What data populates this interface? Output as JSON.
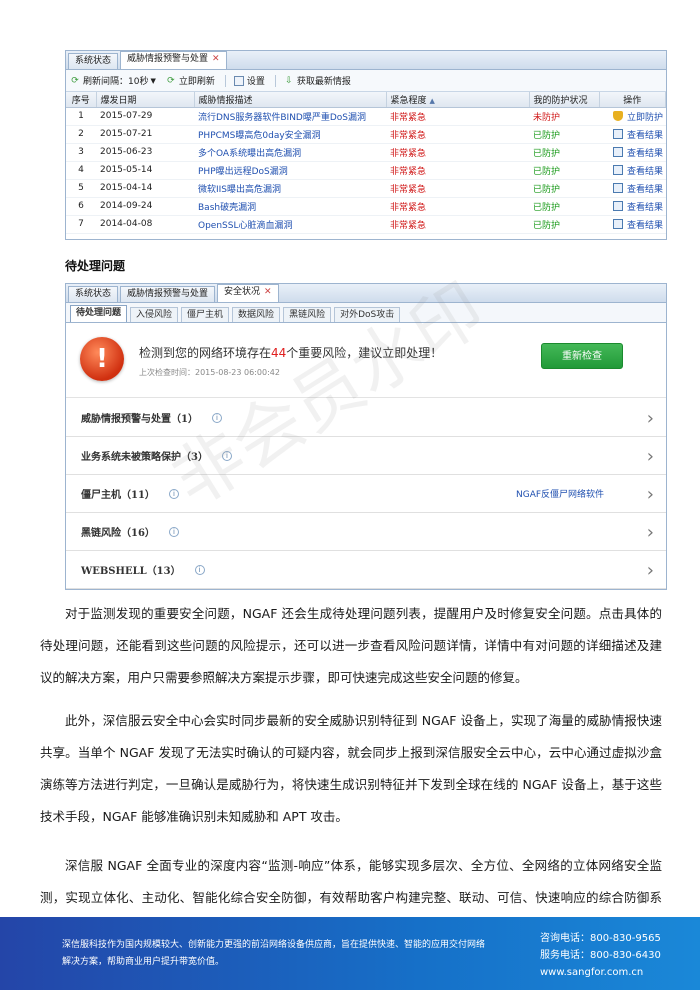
{
  "shot1": {
    "tabs": [
      "系统状态",
      "威胁情报预警与处置"
    ],
    "toolbar": {
      "refresh_interval": "刷新间隔：10秒",
      "refresh_now": "立即刷新",
      "settings": "设置",
      "get_latest": "获取最新情报"
    },
    "columns": [
      "序号",
      "爆发日期",
      "威胁情报描述",
      "紧急程度",
      "我的防护状况",
      "操作"
    ],
    "rows": [
      {
        "idx": "1",
        "date": "2015-07-29",
        "desc": "流行DNS服务器软件BIND曝严重DoS漏洞",
        "urgency": "非常紧急",
        "protect": "未防护",
        "op": "立即防护"
      },
      {
        "idx": "2",
        "date": "2015-07-21",
        "desc": "PHPCMS曝高危0day安全漏洞",
        "urgency": "非常紧急",
        "protect": "已防护",
        "op": "查看结果"
      },
      {
        "idx": "3",
        "date": "2015-06-23",
        "desc": "多个OA系统曝出高危漏洞",
        "urgency": "非常紧急",
        "protect": "已防护",
        "op": "查看结果"
      },
      {
        "idx": "4",
        "date": "2015-05-14",
        "desc": "PHP曝出远程DoS漏洞",
        "urgency": "非常紧急",
        "protect": "已防护",
        "op": "查看结果"
      },
      {
        "idx": "5",
        "date": "2015-04-14",
        "desc": "微软IIS曝出高危漏洞",
        "urgency": "非常紧急",
        "protect": "已防护",
        "op": "查看结果"
      },
      {
        "idx": "6",
        "date": "2014-09-24",
        "desc": "Bash破壳漏洞",
        "urgency": "非常紧急",
        "protect": "已防护",
        "op": "查看结果"
      },
      {
        "idx": "7",
        "date": "2014-04-08",
        "desc": "OpenSSL心脏滴血漏洞",
        "urgency": "非常紧急",
        "protect": "已防护",
        "op": "查看结果"
      }
    ]
  },
  "heading": "待处理问题",
  "shot2": {
    "tabs": [
      "系统状态",
      "威胁情报预警与处置",
      "安全状况"
    ],
    "subtabs": [
      "待处理问题",
      "入侵风险",
      "僵尸主机",
      "数据风险",
      "黑链风险",
      "对外DoS攻击"
    ],
    "alert_pre": "检测到您的网络环境存在",
    "alert_num": "44",
    "alert_post": "个重要风险，建议立即处理！",
    "last_check": "上次检查时间：2015-08-23 06:00:42",
    "recheck": "重新检查",
    "issues": [
      {
        "label": "威胁情报预警与处置（1）",
        "link": ""
      },
      {
        "label": "业务系统未被策略保护（3）",
        "link": ""
      },
      {
        "label": "僵尸主机（11）",
        "link": "NGAF反僵尸网络软件"
      },
      {
        "label": "黑链风险（16）",
        "link": ""
      },
      {
        "label": "WEBSHELL（13）",
        "link": ""
      }
    ]
  },
  "watermark": "非会员水印",
  "paragraphs": [
    "对于监测发现的重要安全问题，NGAF 还会生成待处理问题列表，提醒用户及时修复安全问题。点击具体的待处理问题，还能看到这些问题的风险提示，还可以进一步查看风险问题详情，详情中有对问题的详细描述及建议的解决方案，用户只需要参照解决方案提示步骤，即可快速完成这些安全问题的修复。",
    "此外，深信服云安全中心会实时同步最新的安全威胁识别特征到 NGAF 设备上，实现了海量的威胁情报快速共享。当单个 NGAF 发现了无法实时确认的可疑内容，就会同步上报到深信服安全云中心，云中心通过虚拟沙盒演练等方法进行判定，一旦确认是威胁行为，将快速生成识别特征并下发到全球在线的 NGAF 设备上，基于这些技术手段，NGAF 能够准确识别未知威胁和 APT 攻击。",
    "深信服 NGAF 全面专业的深度内容“监测-响应”体系，能够实现多层次、全方位、全网络的立体网络安全监测，实现立体化、主动化、智能化综合安全防御，有效帮助客户构建完整、联动、可信、快速响应的综合防御系统。"
  ],
  "footer": {
    "text": "深信服科技作为国内规模较大、创新能力更强的前沿网络设备供应商，旨在提供快速、智能的应用交付网络解决方案，帮助商业用户提升带宽价值。",
    "consult": "咨询电话：800-830-9565",
    "service": "服务电话：800-830-6430",
    "website": "www.sangfor.com.cn"
  },
  "colors": {
    "urgent": "#d01818",
    "protected": "#1a9a1a",
    "unprotected": "#d01818",
    "footer": "#1a6cc4",
    "button": "#2aa040"
  }
}
